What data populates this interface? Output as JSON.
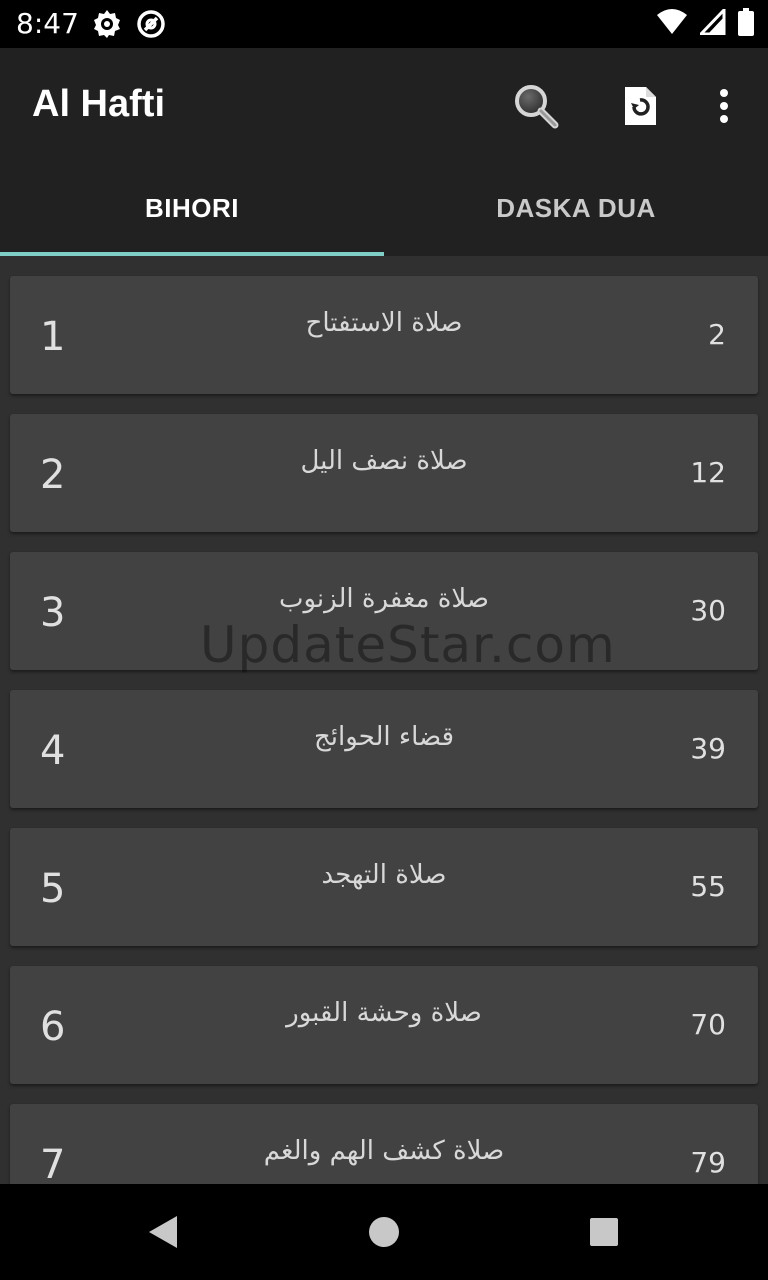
{
  "status_bar": {
    "time": "8:47",
    "left_icons": [
      "settings-gear-notification-icon",
      "at-sign-notification-icon"
    ],
    "right_icons": [
      "wifi-icon",
      "cell-signal-icon",
      "battery-icon"
    ]
  },
  "app_bar": {
    "title": "Al Hafti",
    "actions": [
      "search-icon",
      "refresh-document-icon",
      "overflow-menu-icon"
    ]
  },
  "tabs": [
    {
      "label": "BIHORI",
      "active": true
    },
    {
      "label": "DASKA DUA",
      "active": false
    }
  ],
  "colors": {
    "tab_indicator": "#7fcfc6",
    "card_background": "#424242",
    "list_background": "#303030",
    "app_bar_background": "#212121"
  },
  "items": [
    {
      "index": "1",
      "title": "صلاة الاستفتاح",
      "page": "2"
    },
    {
      "index": "2",
      "title": "صلاة نصف اليل",
      "page": "12"
    },
    {
      "index": "3",
      "title": "صلاة مغفرة الزنوب",
      "page": "30"
    },
    {
      "index": "4",
      "title": "قضاء الحوائج",
      "page": "39"
    },
    {
      "index": "5",
      "title": "صلاة التهجد",
      "page": "55"
    },
    {
      "index": "6",
      "title": "صلاة وحشة القبور",
      "page": "70"
    },
    {
      "index": "7",
      "title": "صلاة كشف الهم والغم",
      "page": "79"
    }
  ],
  "watermark": "UpdateStar.com",
  "nav_bar": {
    "buttons": [
      "back-icon",
      "home-icon",
      "recents-icon"
    ]
  }
}
